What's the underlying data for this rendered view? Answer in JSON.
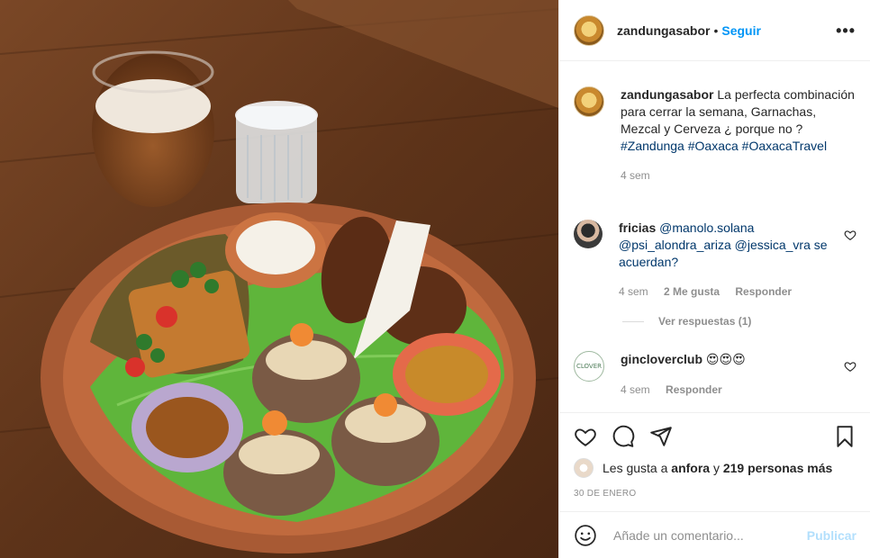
{
  "post": {
    "username": "zandungasabor",
    "separator": "•",
    "follow_label": "Seguir",
    "more_label": "•••"
  },
  "caption": {
    "username": "zandungasabor",
    "text": "La perfecta combinación para cerrar la semana, Garnachas, Mezcal y Cerveza ¿ porque no ?",
    "hashtags": "#Zandunga #Oaxaca #OaxacaTravel",
    "time": "4 sem"
  },
  "comments": [
    {
      "username": "fricias",
      "text": "@manolo.solana @psi_alondra_ariza @jessica_vra se acuerdan?",
      "time": "4 sem",
      "likes": "2 Me gusta",
      "reply": "Responder",
      "view_replies": "Ver respuestas (1)"
    },
    {
      "username": "gincloverclub",
      "text": "😍😍😍",
      "time": "4 sem",
      "reply": "Responder"
    }
  ],
  "avatar_text": {
    "gin": "CLOVER"
  },
  "likes": {
    "prefix": "Les gusta a",
    "user": "anfora",
    "middle": "y",
    "count": "219 personas más"
  },
  "date": "30 DE ENERO",
  "add_comment": {
    "placeholder": "Añade un comentario...",
    "publish_label": "Publicar"
  },
  "icons": [
    "heart-icon",
    "comment-icon",
    "share-icon",
    "bookmark-icon",
    "emoji-icon",
    "more-icon"
  ],
  "colors": {
    "accent": "#0095f6",
    "link": "#00376b",
    "muted": "#8e8e8e",
    "publish_disabled": "#b2dffc"
  }
}
